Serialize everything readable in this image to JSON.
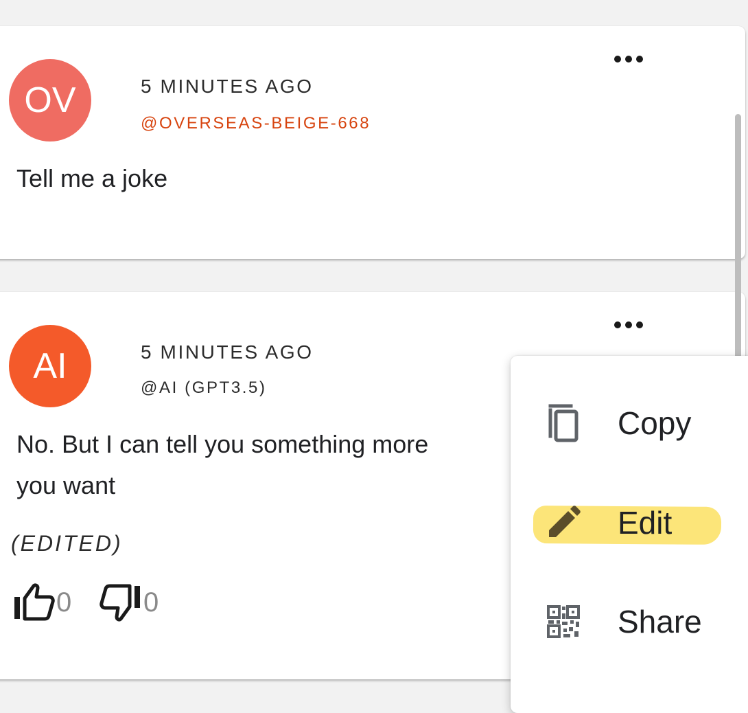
{
  "colors": {
    "user_avatar": "#ef6c62",
    "ai_avatar": "#f45a2a",
    "user_handle": "#d7440f",
    "highlight": "#fce26a"
  },
  "messages": [
    {
      "avatar_initials": "OV",
      "timestamp": "5 MINUTES AGO",
      "handle": "@OVERSEAS-BEIGE-668",
      "text": "Tell me a joke"
    },
    {
      "avatar_initials": "AI",
      "timestamp": "5 MINUTES AGO",
      "handle": "@AI (GPT3.5)",
      "text_line1": "No. But I can tell you something more",
      "text_line2": "you want",
      "edited_label": "(EDITED)",
      "likes": "0",
      "dislikes": "0"
    }
  ],
  "context_menu": {
    "items": [
      {
        "label": "Copy",
        "icon": "copy-icon"
      },
      {
        "label": "Edit",
        "icon": "pencil-icon"
      },
      {
        "label": "Share",
        "icon": "qr-code-icon"
      }
    ]
  }
}
